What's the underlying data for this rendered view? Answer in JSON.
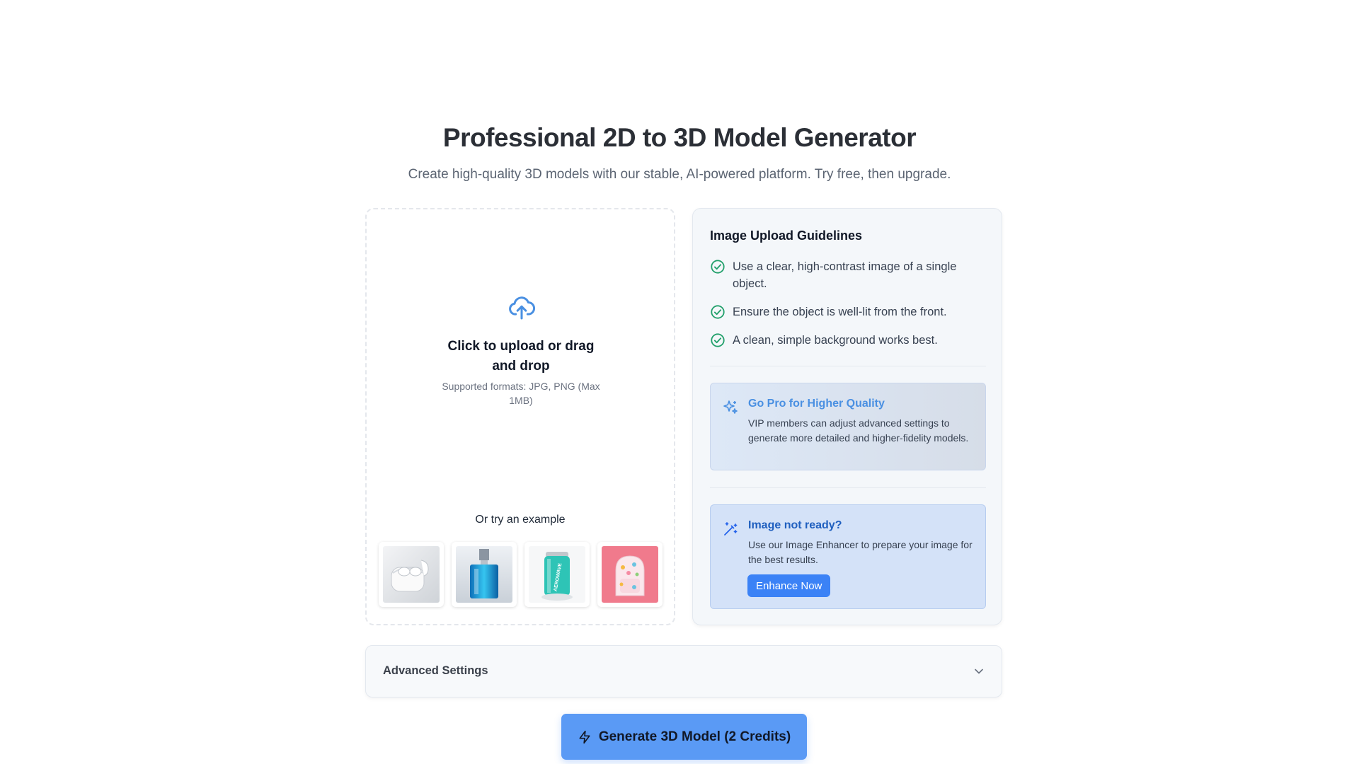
{
  "hero": {
    "title": "Professional 2D to 3D Model Generator",
    "subtitle": "Create high-quality 3D models with our stable, AI-powered platform. Try free, then upgrade."
  },
  "upload": {
    "icon": "cloud-upload-icon",
    "title": "Click to upload or drag and drop",
    "formats": "Supported formats: JPG, PNG (Max 1MB)",
    "examples_label": "Or try an example",
    "examples": [
      {
        "name": "earbuds-example",
        "icon": "earbuds"
      },
      {
        "name": "perfume-bottle-example",
        "icon": "perfume"
      },
      {
        "name": "soda-can-example",
        "icon": "can",
        "text": "AEROWAVE"
      },
      {
        "name": "backpack-example",
        "icon": "backpack"
      }
    ]
  },
  "guidelines": {
    "title": "Image Upload Guidelines",
    "items": [
      "Use a clear, high-contrast image of a single object.",
      "Ensure the object is well-lit from the front.",
      "A clean, simple background works best."
    ],
    "pro": {
      "icon": "sparkles-icon",
      "title": "Go Pro for Higher Quality",
      "text": "VIP members can adjust advanced settings to generate more detailed and higher-fidelity models."
    },
    "enhance": {
      "icon": "magic-wand-icon",
      "title": "Image not ready?",
      "text": "Use our Image Enhancer to prepare your image for the best results.",
      "button": "Enhance Now"
    }
  },
  "advanced": {
    "label": "Advanced Settings",
    "icon": "chevron-down-icon"
  },
  "generate": {
    "label": "Generate 3D Model (2 Credits)",
    "icon": "lightning-icon"
  },
  "colors": {
    "accent": "#3b82f6",
    "check": "#22a06b",
    "generate_bg": "#5a9af5"
  }
}
